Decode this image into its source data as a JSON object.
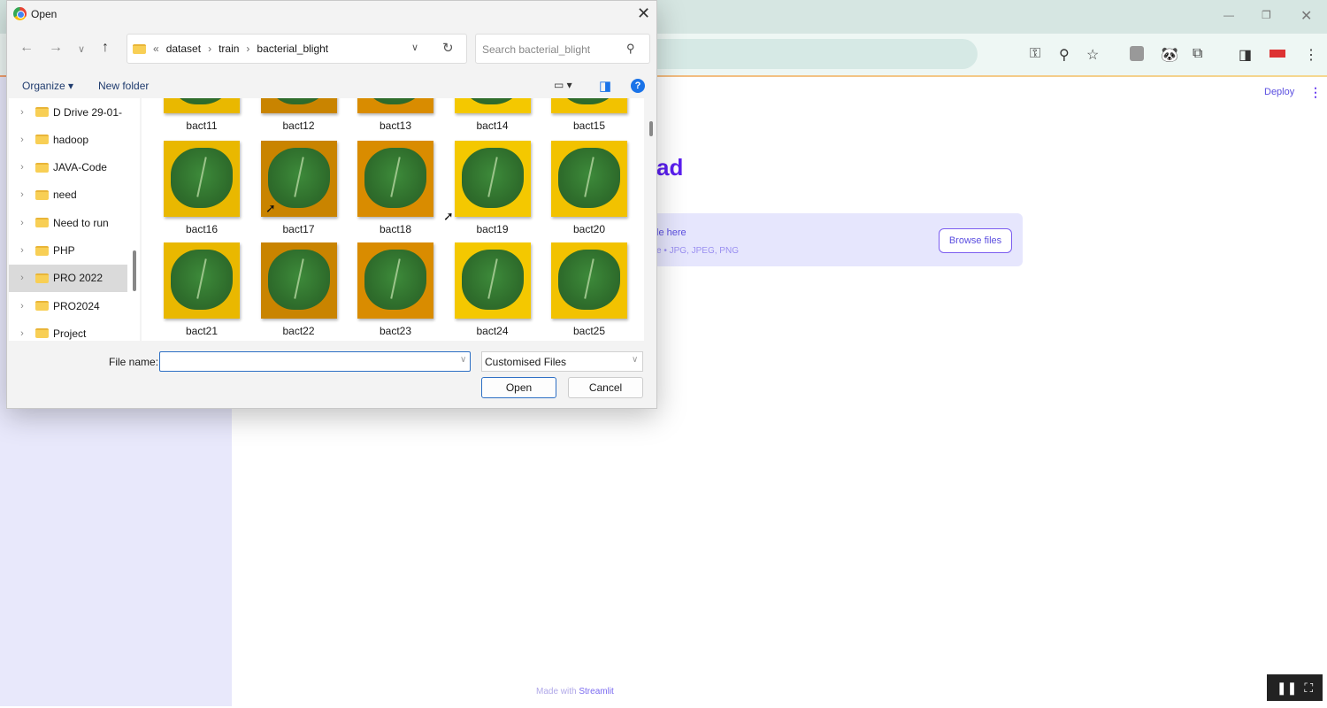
{
  "browser": {
    "window_controls": [
      "minimize",
      "restore",
      "close"
    ],
    "toolbar_icons": [
      "key-icon",
      "zoom-icon",
      "star-icon",
      "profile-icon",
      "panda-extension-icon",
      "extensions-icon",
      "side-panel-icon",
      "extension-icon",
      "more-icon"
    ]
  },
  "streamlit": {
    "deploy": "Deploy",
    "title_partial": "ad",
    "uploader_text": "le here",
    "uploader_types": "e • JPG, JPEG, PNG",
    "browse_label": "Browse files",
    "footer_prefix": "Made with",
    "footer_brand": "Streamlit"
  },
  "dialog": {
    "title": "Open",
    "breadcrumb": [
      "dataset",
      "train",
      "bacterial_blight"
    ],
    "search_placeholder": "Search bacterial_blight",
    "organize": "Organize ▾",
    "new_folder": "New folder",
    "help": "?",
    "tree": [
      {
        "label": "D Drive 29-01-",
        "selected": false
      },
      {
        "label": "hadoop",
        "selected": false
      },
      {
        "label": "JAVA-Code",
        "selected": false
      },
      {
        "label": "need",
        "selected": false
      },
      {
        "label": "Need to run",
        "selected": false
      },
      {
        "label": "PHP",
        "selected": false
      },
      {
        "label": "PRO 2022",
        "selected": true
      },
      {
        "label": "PRO2024",
        "selected": false
      },
      {
        "label": "Project",
        "selected": false
      }
    ],
    "files": [
      "bact11",
      "bact12",
      "bact13",
      "bact14",
      "bact15",
      "bact16",
      "bact17",
      "bact18",
      "bact19",
      "bact20",
      "bact21",
      "bact22",
      "bact23",
      "bact24",
      "bact25"
    ],
    "file_name_label": "File name:",
    "file_name_value": "",
    "file_type": "Customised Files",
    "open": "Open",
    "cancel": "Cancel",
    "colors": {
      "thumb_bg": [
        "#e9b800",
        "#d98c00",
        "#f2c200",
        "#c98400",
        "#f4c800"
      ]
    }
  }
}
